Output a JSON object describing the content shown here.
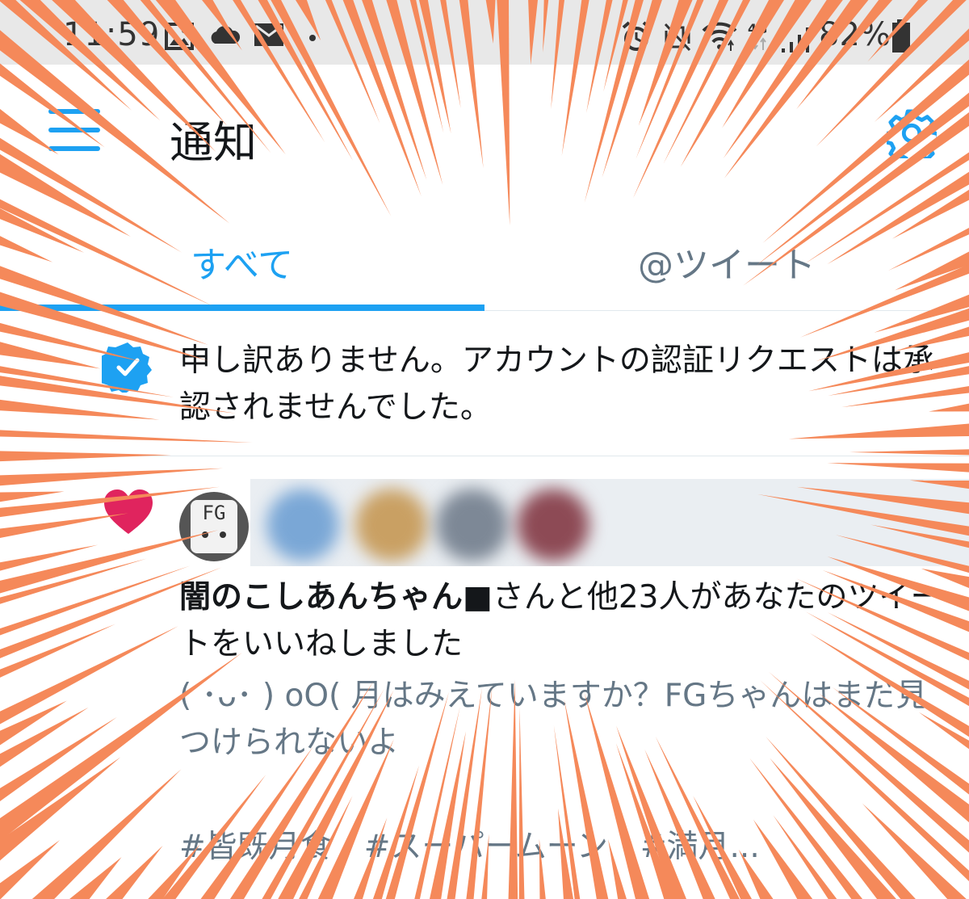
{
  "status_bar": {
    "time": "11:59",
    "left_icons": [
      "image-icon",
      "cloud-icon",
      "mail-icon",
      "dot-icon"
    ],
    "right_icons": [
      "alarm-icon",
      "vibrate-icon",
      "wifi-icon",
      "network-4g-icon",
      "signal-icon",
      "battery-icon"
    ],
    "network_label": "4G",
    "battery_percent": "82%"
  },
  "app_bar": {
    "title": "通知",
    "menu_icon": "hamburger-menu-icon",
    "settings_icon": "gear-icon"
  },
  "tabs": [
    {
      "label": "すべて",
      "active": true
    },
    {
      "label": "@ツイート",
      "active": false
    }
  ],
  "notifications": [
    {
      "type": "verification",
      "icon": "verified-badge-icon",
      "text": "申し訳ありません。アカウントの認証リクエストは承認されませんでした。"
    },
    {
      "type": "like",
      "icon": "heart-icon",
      "avatar_label": "FG",
      "liker_name": "闇のこしあんちゃん■",
      "liker_suffix": "さんと他23人があなたのツイートをいいねしました",
      "tweet_text": "( ･ᴗ･ ) oO( 月はみえていますか？FGちゃんはまだ見つけられないよ",
      "hashtags": [
        "#皆既月食",
        "#スーパームーン",
        "#満月..."
      ]
    }
  ],
  "colors": {
    "accent": "#1da1f2",
    "heart": "#e0245e",
    "secondary_text": "#657786",
    "primary_text": "#14171a",
    "status_bar_bg": "#e8e8e8",
    "burst_lines": "#f5895a"
  }
}
